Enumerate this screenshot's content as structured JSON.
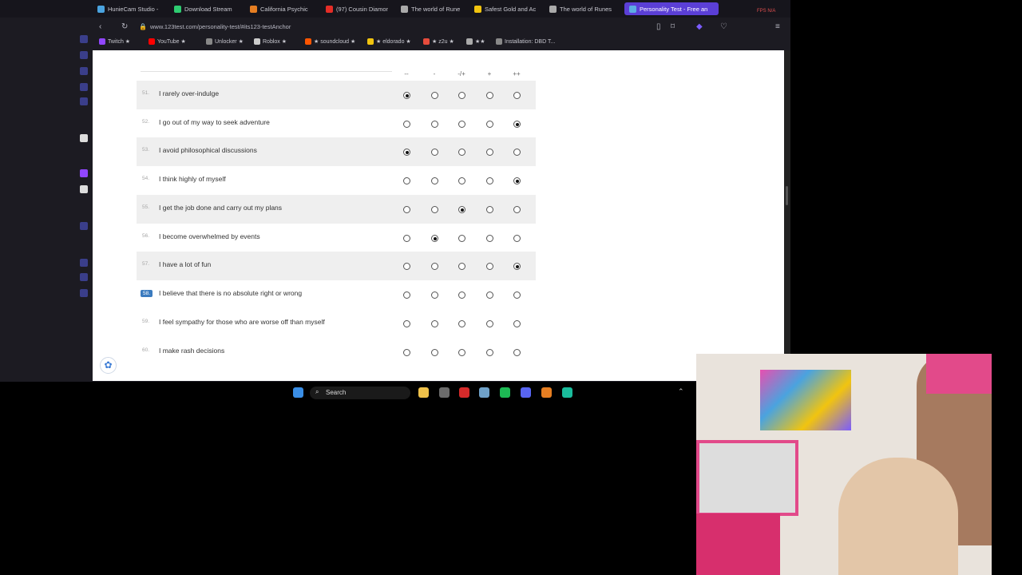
{
  "browser": {
    "tabs": [
      {
        "title": "HunieCam Studio -",
        "color": "#4aa3df"
      },
      {
        "title": "Download Stream",
        "color": "#2ecc71"
      },
      {
        "title": "California Psychic",
        "color": "#e67e22"
      },
      {
        "title": "(97) Cousin Diamon",
        "color": "#e52d27"
      },
      {
        "title": "The world of Rune",
        "color": "#aaaaaa"
      },
      {
        "title": "Safest Gold and Ac",
        "color": "#f1c40f"
      },
      {
        "title": "The world of Runes",
        "color": "#aaaaaa"
      },
      {
        "title": "Personality Test - Free an",
        "color": "#5dade2"
      }
    ],
    "url": "www.123test.com/personality-test/#its123-testAnchor",
    "fps": "FPS N/A",
    "bookmarks": [
      {
        "label": "Twitch ★",
        "color": "#9146ff"
      },
      {
        "label": "YouTube ★",
        "color": "#ff0000"
      },
      {
        "label": "Unlocker ★",
        "color": "#888888"
      },
      {
        "label": "Roblox ★",
        "color": "#cccccc"
      },
      {
        "label": "★ soundcloud ★",
        "color": "#ff5500"
      },
      {
        "label": "★ eldorado ★",
        "color": "#f1c40f"
      },
      {
        "label": "★ z2u ★",
        "color": "#e74c3c"
      },
      {
        "label": "★★",
        "color": "#aaaaaa"
      },
      {
        "label": "Installation: DBD T...",
        "color": "#888888"
      }
    ]
  },
  "test": {
    "scale_headers": [
      "--",
      "-",
      "-/+",
      "+",
      "++"
    ],
    "questions": [
      {
        "num": "51.",
        "text": "I rarely over-indulge",
        "selected": 0,
        "shaded": true
      },
      {
        "num": "52.",
        "text": "I go out of my way to seek adventure",
        "selected": 4,
        "shaded": false
      },
      {
        "num": "53.",
        "text": "I avoid philosophical discussions",
        "selected": 0,
        "shaded": true
      },
      {
        "num": "54.",
        "text": "I think highly of myself",
        "selected": 4,
        "shaded": false
      },
      {
        "num": "55.",
        "text": "I get the job done and carry out my plans",
        "selected": 2,
        "shaded": true
      },
      {
        "num": "56.",
        "text": "I become overwhelmed by events",
        "selected": 1,
        "shaded": false
      },
      {
        "num": "57.",
        "text": "I have a lot of fun",
        "selected": 4,
        "shaded": true
      },
      {
        "num": "58.",
        "text": "I believe that there is no absolute right or wrong",
        "selected": -1,
        "shaded": false,
        "current": true
      },
      {
        "num": "59.",
        "text": "I feel sympathy for those who are worse off than myself",
        "selected": -1,
        "shaded": false
      },
      {
        "num": "60.",
        "text": "I make rash decisions",
        "selected": -1,
        "shaded": false
      }
    ]
  },
  "taskbar": {
    "search_label": "Search",
    "icons": [
      {
        "name": "windows-start-icon",
        "color": "#3a8ee6"
      },
      {
        "name": "file-explorer-icon",
        "color": "#f0c24a"
      },
      {
        "name": "mail-icon",
        "color": "#6b6b6b"
      },
      {
        "name": "opera-gx-icon",
        "color": "#d62a2a"
      },
      {
        "name": "steam-icon",
        "color": "#6fa1c9"
      },
      {
        "name": "spotify-icon",
        "color": "#1db954"
      },
      {
        "name": "discord-icon",
        "color": "#5865f2"
      },
      {
        "name": "app-icon",
        "color": "#e67e22"
      },
      {
        "name": "app2-icon",
        "color": "#1abc9c"
      }
    ]
  }
}
